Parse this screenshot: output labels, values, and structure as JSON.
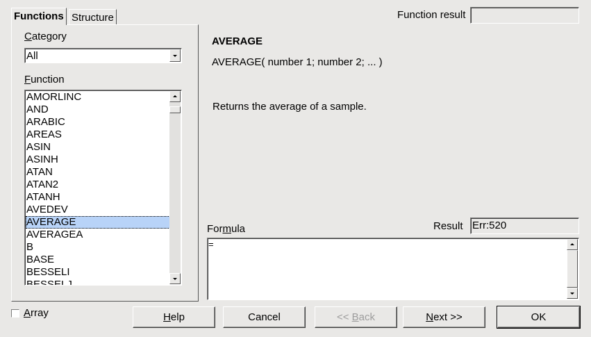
{
  "tabs": [
    {
      "label": "Functions",
      "active": true
    },
    {
      "label": "Structure",
      "active": false
    }
  ],
  "function_result": {
    "label": "Function result",
    "value": ""
  },
  "category": {
    "label_prefix": "",
    "label_underlined": "C",
    "label_rest": "ategory",
    "selected": "All"
  },
  "function": {
    "label_underlined": "F",
    "label_rest": "unction",
    "items": [
      "AMORLINC",
      "AND",
      "ARABIC",
      "AREAS",
      "ASIN",
      "ASINH",
      "ATAN",
      "ATAN2",
      "ATANH",
      "AVEDEV",
      "AVERAGE",
      "AVERAGEA",
      "B",
      "BASE",
      "BESSELI",
      "BESSELJ"
    ],
    "selected_index": 10
  },
  "description": {
    "name": "AVERAGE",
    "syntax": "AVERAGE( number 1; number 2; ...  )",
    "text": "Returns the average of a sample."
  },
  "formula": {
    "label_pre": "For",
    "label_underlined": "m",
    "label_rest": "ula",
    "value": "="
  },
  "result": {
    "label": "Result",
    "value": "Err:520"
  },
  "array": {
    "label_underlined": "A",
    "label_rest": "rray",
    "checked": false
  },
  "buttons": {
    "help": {
      "underlined": "H",
      "rest": "elp"
    },
    "cancel": {
      "label": "Cancel"
    },
    "back": {
      "pre": "<< ",
      "underlined": "B",
      "rest": "ack"
    },
    "next": {
      "underlined": "N",
      "rest": "ext >>"
    },
    "ok": {
      "label": "OK"
    }
  }
}
